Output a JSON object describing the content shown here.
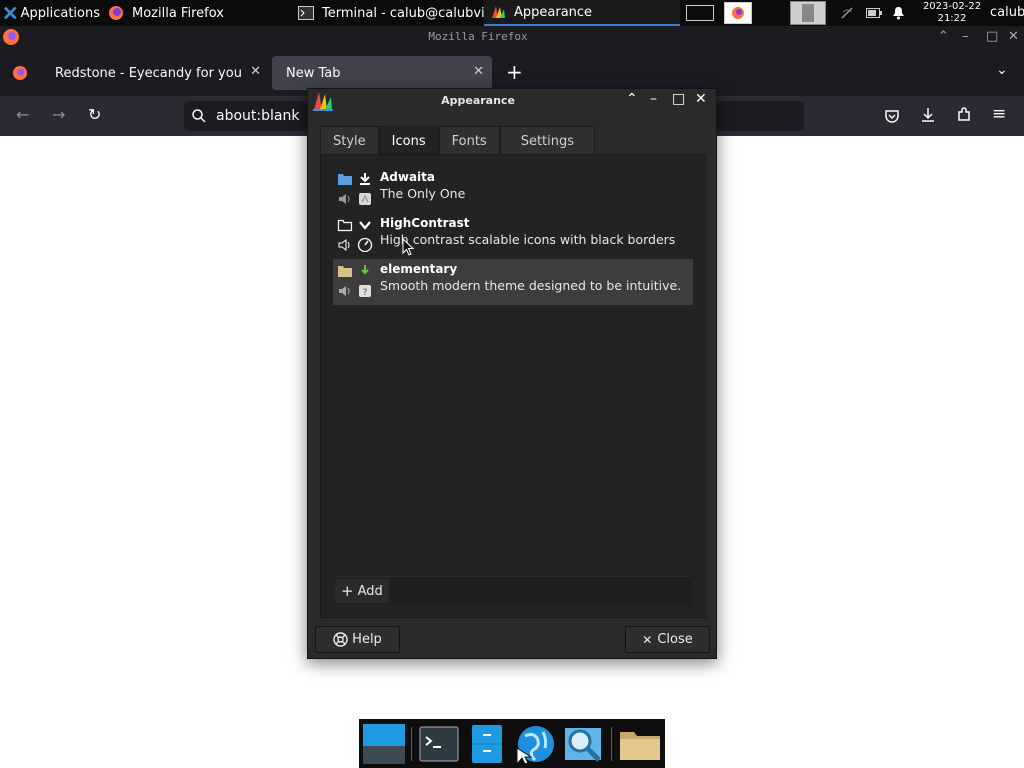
{
  "panel": {
    "applications_label": "Applications",
    "tasks": [
      {
        "label": "Mozilla Firefox",
        "icon": "firefox-icon"
      },
      {
        "label": "Terminal - calub@calubvi…",
        "icon": "terminal-icon"
      },
      {
        "label": "Appearance",
        "icon": "appearance-icon"
      }
    ],
    "clock_date": "2023-02-22",
    "clock_time": "21:22",
    "user": "calub"
  },
  "firefox": {
    "window_title": "Mozilla Firefox",
    "tabs": [
      {
        "label": "Redstone - Eyecandy for your X"
      },
      {
        "label": "New Tab"
      }
    ],
    "url": "about:blank"
  },
  "dialog": {
    "title": "Appearance",
    "tabs": [
      "Style",
      "Icons",
      "Fonts",
      "Settings"
    ],
    "selected_tab": "Icons",
    "themes": [
      {
        "name": "Adwaita",
        "description": "The Only One"
      },
      {
        "name": "HighContrast",
        "description": "High contrast scalable icons with black borders"
      },
      {
        "name": "elementary",
        "description": "Smooth modern theme designed to be intuitive."
      }
    ],
    "selected_theme": "elementary",
    "add_label": "Add",
    "help_label": "Help",
    "close_label": "Close"
  },
  "dock": {
    "items": [
      "desktop-icon",
      "terminal-icon",
      "file-manager-icon",
      "web-browser-icon",
      "search-icon",
      "folder-icon"
    ]
  },
  "colors": {
    "panel_bg": "#0b0b0b",
    "firefox_bg": "#1c1b22",
    "dialog_bg": "#2a2a2a",
    "selection": "#3d3d3d",
    "accent": "#3a7dd8"
  }
}
